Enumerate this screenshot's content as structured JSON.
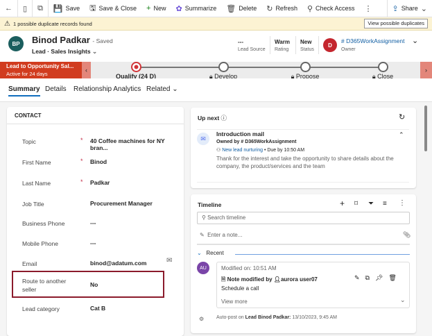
{
  "toolbar": {
    "save": "Save",
    "save_close": "Save & Close",
    "new": "New",
    "summarize": "Summarize",
    "delete": "Delete",
    "refresh": "Refresh",
    "check_access": "Check Access",
    "share": "Share"
  },
  "warning": {
    "text": "1 possible duplicate records found",
    "button": "View possible duplicates"
  },
  "header": {
    "initials": "BP",
    "name": "Binod Padkar",
    "saved": "- Saved",
    "entity": "Lead",
    "form": "Sales Insights",
    "lead_source_value": "---",
    "lead_source_label": "Lead Source",
    "rating_value": "Warm",
    "rating_label": "Rating",
    "status_value": "New",
    "status_label": "Status",
    "owner_initial": "D",
    "owner_name": "# D365WorkAssignment",
    "owner_label": "Owner"
  },
  "bpf": {
    "title": "Lead to Opportunity Sal...",
    "subtitle": "Active for 24 days",
    "stages": [
      "Qualify  (24 D)",
      "Develop",
      "Propose",
      "Close"
    ]
  },
  "tabs": [
    "Summary",
    "Details",
    "Relationship Analytics",
    "Related"
  ],
  "contact": {
    "heading": "CONTACT",
    "fields": [
      {
        "label": "Topic",
        "value": "40 Coffee machines for NY bran...",
        "required": true
      },
      {
        "label": "First Name",
        "value": "Binod",
        "required": true
      },
      {
        "label": "Last Name",
        "value": "Padkar",
        "required": true
      },
      {
        "label": "Job Title",
        "value": "Procurement Manager",
        "required": false
      },
      {
        "label": "Business Phone",
        "value": "---",
        "required": false
      },
      {
        "label": "Mobile Phone",
        "value": "---",
        "required": false
      },
      {
        "label": "Email",
        "value": "binod@adatum.com",
        "required": false
      },
      {
        "label": "Route to another seller",
        "value": "No",
        "required": false
      },
      {
        "label": "Lead category",
        "value": "Cat B",
        "required": false
      }
    ]
  },
  "upnext": {
    "title": "Up next",
    "item_title": "Introduction mail",
    "owned_by": "Owned by # D365WorkAssignment",
    "sequence": "New lead nurturing",
    "due": "• Due by 10:50 AM",
    "description": "Thank for the interest and take the opportunity to share details about the company, the product/services and the team"
  },
  "timeline": {
    "title": "Timeline",
    "search_placeholder": "Search timeline",
    "note_placeholder": "Enter a note...",
    "recent": "Recent",
    "entry": {
      "initials": "AU",
      "modified": "Modified on: 10:51 AM",
      "title_prefix": "Note modified by",
      "user": "aurora user07",
      "body": "Schedule a call",
      "view_more": "View more"
    },
    "autopost": {
      "prefix": "Auto-post on",
      "subject": "Lead Binod Padkar:",
      "date": "13/10/2023, 9:45 AM"
    }
  }
}
